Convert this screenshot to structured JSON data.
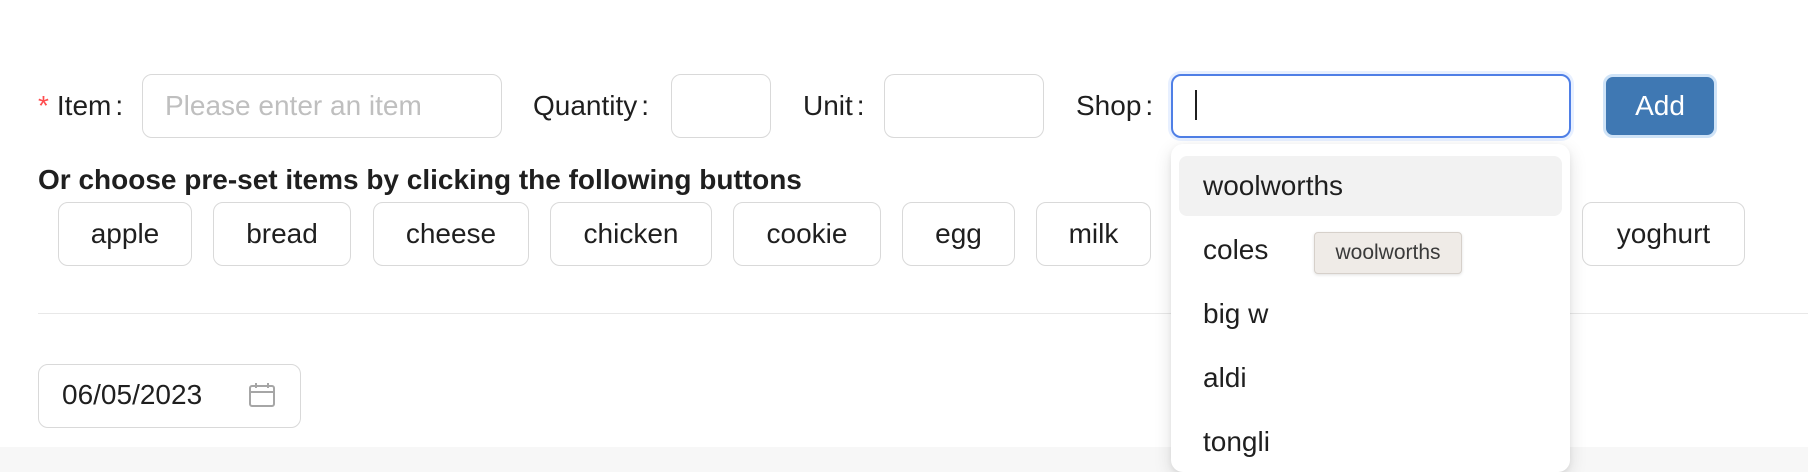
{
  "form": {
    "item_required_mark": "*",
    "item_label": "Item",
    "item_placeholder": "Please enter an item",
    "item_value": "",
    "quantity_label": "Quantity",
    "quantity_value": "",
    "unit_label": "Unit",
    "unit_value": "",
    "shop_label": "Shop",
    "shop_value": "",
    "colon": ":",
    "add_label": "Add"
  },
  "presets": {
    "heading": "Or choose pre-set items by clicking the following buttons",
    "items": [
      "apple",
      "bread",
      "cheese",
      "chicken",
      "cookie",
      "egg",
      "milk",
      "yoghurt"
    ]
  },
  "date": {
    "value": "06/05/2023",
    "icon": "calendar-icon"
  },
  "shop_dropdown": {
    "options": [
      "woolworths",
      "coles",
      "big w",
      "aldi",
      "tongli"
    ],
    "active_option": "woolworths",
    "tooltip": "woolworths"
  },
  "colors": {
    "primary": "#3f78b3",
    "focus_border": "#4f7fe6",
    "required": "#ff4d4f"
  }
}
